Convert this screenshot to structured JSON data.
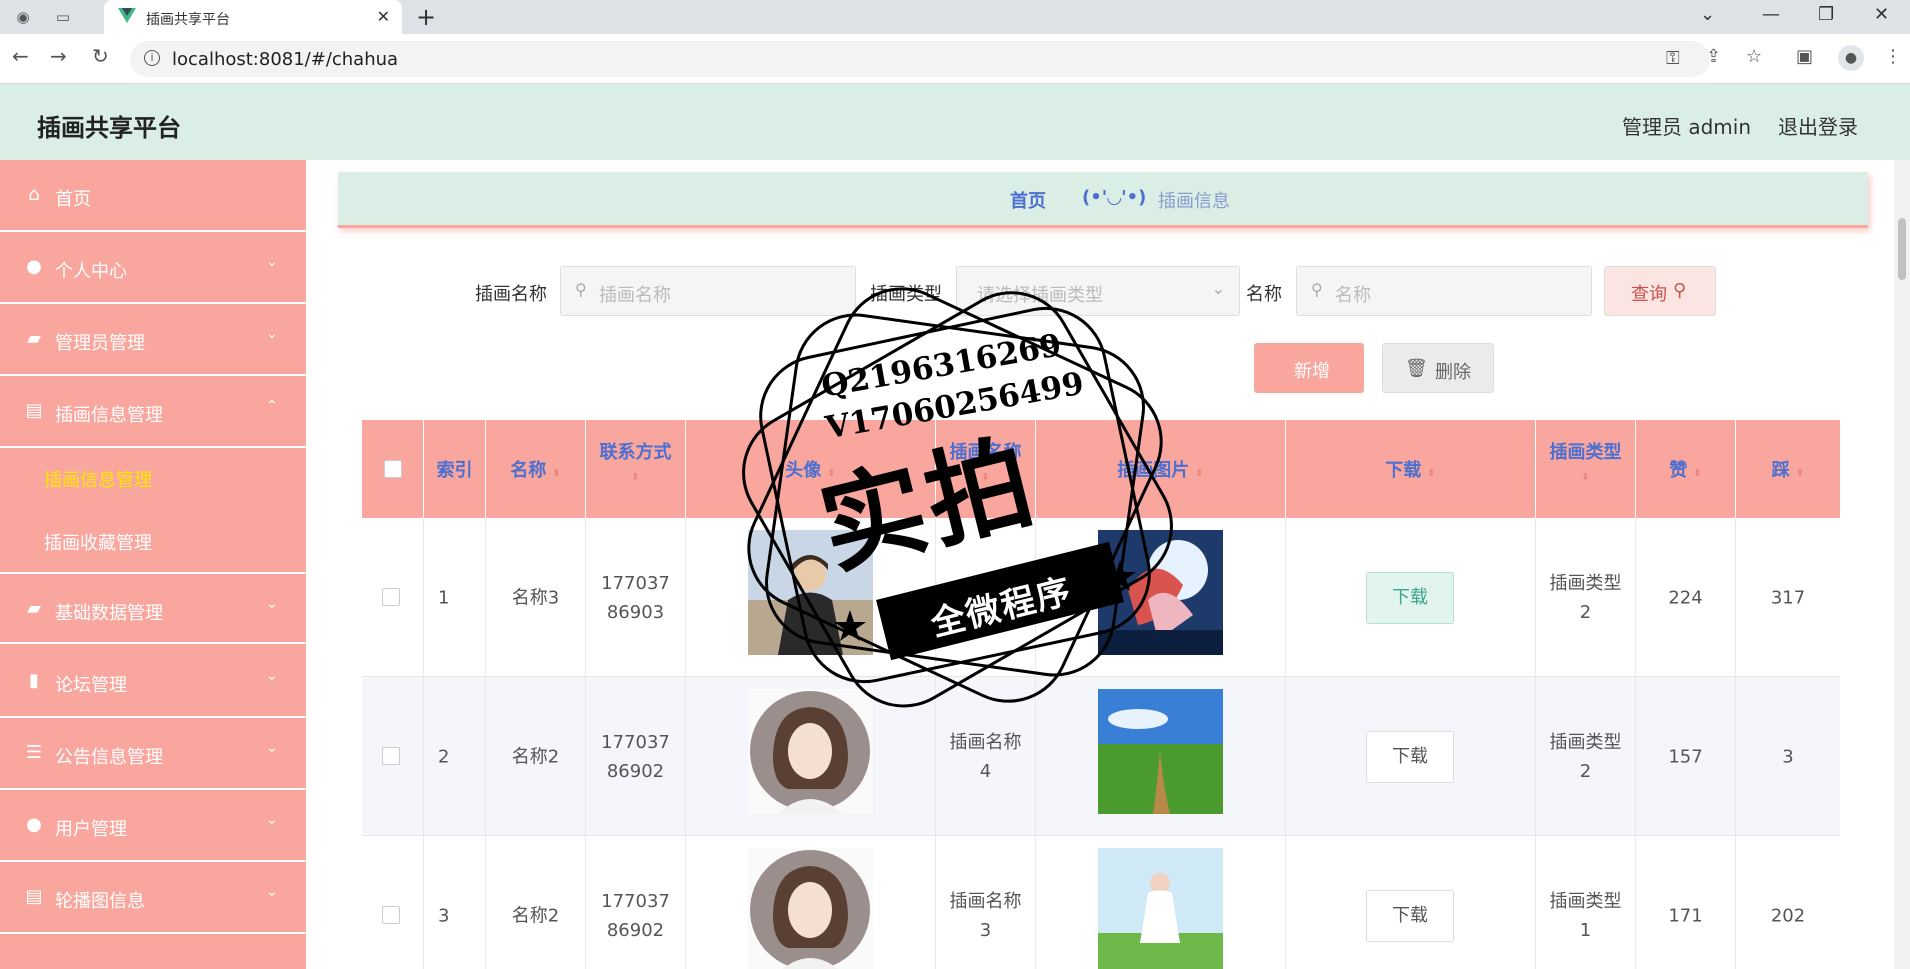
{
  "browser": {
    "tab_title": "插画共享平台",
    "url": "localhost:8081/#/chahua"
  },
  "header": {
    "app_title": "插画共享平台",
    "user_label": "管理员 admin",
    "logout_label": "退出登录"
  },
  "sidebar": {
    "items": [
      {
        "label": "首页",
        "icon": "home-icon"
      },
      {
        "label": "个人中心",
        "icon": "user-icon"
      },
      {
        "label": "管理员管理",
        "icon": "briefcase-icon"
      },
      {
        "label": "插画信息管理",
        "icon": "document-icon"
      },
      {
        "label": "基础数据管理",
        "icon": "briefcase-icon"
      },
      {
        "label": "论坛管理",
        "icon": "bar-chart-icon"
      },
      {
        "label": "公告信息管理",
        "icon": "list-icon"
      },
      {
        "label": "用户管理",
        "icon": "user-icon"
      },
      {
        "label": "轮播图信息",
        "icon": "document-icon"
      }
    ],
    "subitems": [
      {
        "label": "插画信息管理",
        "active": true
      },
      {
        "label": "插画收藏管理",
        "active": false
      }
    ]
  },
  "breadcrumb": {
    "home": "首页",
    "separator": "(•'◡'•)",
    "current": "插画信息"
  },
  "filters": {
    "name_label": "插画名称",
    "name_placeholder": "插画名称",
    "type_label": "插画类型",
    "type_placeholder": "请选择插画类型",
    "title_label": "名称",
    "title_placeholder": "名称",
    "query_button": "查询"
  },
  "actions": {
    "add_button": "新增",
    "delete_button": "删除"
  },
  "table": {
    "headers": [
      "索引",
      "名称",
      "联系方式",
      "头像",
      "插画名称",
      "插画图片",
      "下载",
      "插画类型",
      "赞",
      "踩"
    ],
    "rows": [
      {
        "index": "1",
        "name": "名称3",
        "phone": "17703786903",
        "illus_name": "插画名称",
        "download": "下载",
        "type": "插画类型2",
        "likes": "224",
        "dislikes": "317"
      },
      {
        "index": "2",
        "name": "名称2",
        "phone": "17703786902",
        "illus_name": "插画名称4",
        "download": "下载",
        "type": "插画类型2",
        "likes": "157",
        "dislikes": "3"
      },
      {
        "index": "3",
        "name": "名称2",
        "phone": "17703786902",
        "illus_name": "插画名称3",
        "download": "下载",
        "type": "插画类型1",
        "likes": "171",
        "dislikes": "202"
      }
    ]
  },
  "watermark": {
    "line1": "Q2196316269",
    "line2": "V17060256499",
    "big": "实拍",
    "banner": "全微程序"
  },
  "colors": {
    "accent": "#f9a79e",
    "header_bg": "#daeee6",
    "link_blue": "#4c6fd0",
    "active_sub": "#ffe600"
  }
}
